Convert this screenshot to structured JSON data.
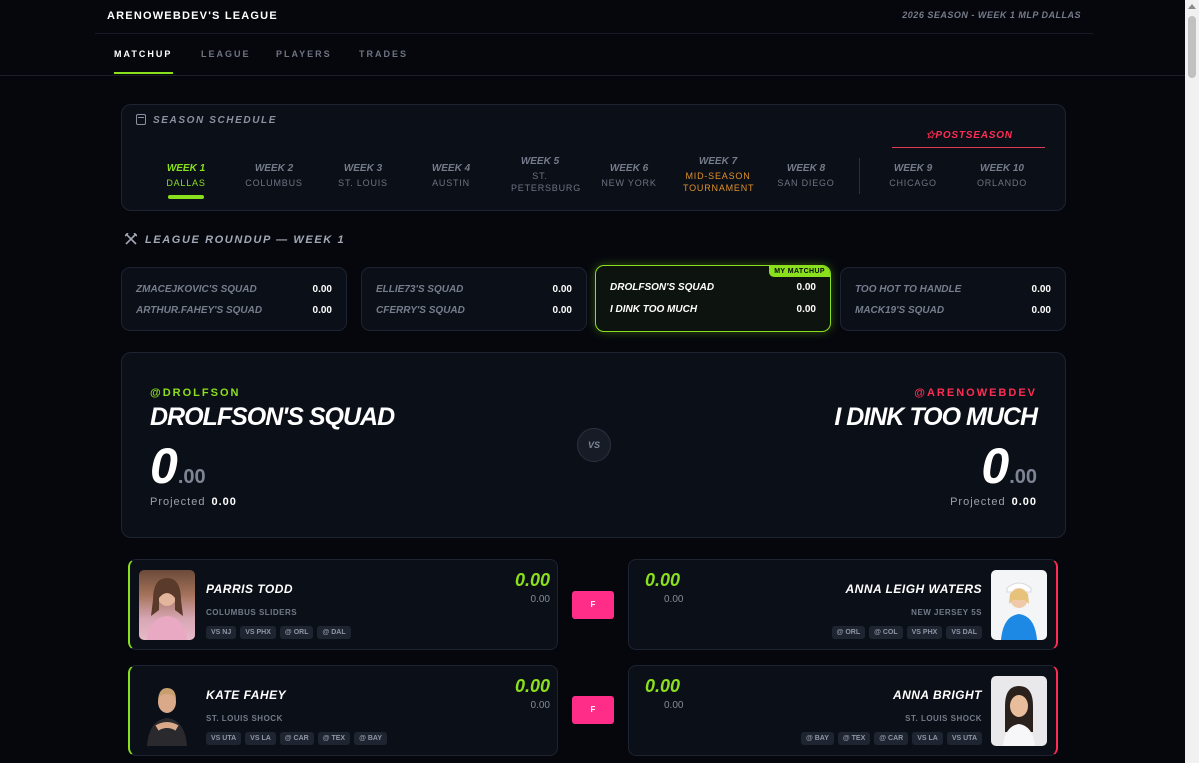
{
  "header": {
    "league_name": "ARENOWEBDEV'S LEAGUE",
    "season_info": "2026 SEASON - WEEK 1 MLP DALLAS"
  },
  "tabs": [
    {
      "label": "MATCHUP"
    },
    {
      "label": "LEAGUE"
    },
    {
      "label": "PLAYERS"
    },
    {
      "label": "TRADES"
    }
  ],
  "schedule": {
    "title": "SEASON SCHEDULE",
    "postseason_label": "✩POSTSEASON",
    "weeks": [
      {
        "week": "WEEK 1",
        "city": "DALLAS"
      },
      {
        "week": "WEEK 2",
        "city": "COLUMBUS"
      },
      {
        "week": "WEEK 3",
        "city": "ST. LOUIS"
      },
      {
        "week": "WEEK 4",
        "city": "AUSTIN"
      },
      {
        "week": "WEEK 5",
        "city": "ST. PETERSBURG"
      },
      {
        "week": "WEEK 6",
        "city": "NEW YORK"
      },
      {
        "week": "WEEK 7",
        "city": "MID-SEASON TOURNAMENT"
      },
      {
        "week": "WEEK 8",
        "city": "SAN DIEGO"
      },
      {
        "week": "WEEK 9",
        "city": "CHICAGO"
      },
      {
        "week": "WEEK 10",
        "city": "ORLANDO"
      }
    ]
  },
  "roundup": {
    "title": "LEAGUE ROUNDUP — WEEK 1",
    "my_matchup_badge": "MY MATCHUP",
    "matchups": [
      {
        "team1": "ZMACEJKOVIC'S SQUAD",
        "score1": "0.00",
        "team2": "ARTHUR.FAHEY'S SQUAD",
        "score2": "0.00"
      },
      {
        "team1": "ELLIE73'S SQUAD",
        "score1": "0.00",
        "team2": "CFERRY'S SQUAD",
        "score2": "0.00"
      },
      {
        "team1": "DROLFSON'S SQUAD",
        "score1": "0.00",
        "team2": "I DINK TOO MUCH",
        "score2": "0.00"
      },
      {
        "team1": "TOO HOT TO HANDLE",
        "score1": "0.00",
        "team2": "MACK19'S SQUAD",
        "score2": "0.00"
      }
    ]
  },
  "matchup": {
    "vs_label": "VS",
    "projected_label": "Projected",
    "home": {
      "handle": "@DROLFSON",
      "team": "DROLFSON'S SQUAD",
      "score_int": "0",
      "score_dec": ".00",
      "projected": "0.00"
    },
    "away": {
      "handle": "@ARENOWEBDEV",
      "team": "I DINK TOO MUCH",
      "score_int": "0",
      "score_dec": ".00",
      "projected": "0.00"
    }
  },
  "lineup": [
    {
      "slot": "F",
      "home": {
        "name": "PARRIS TODD",
        "team": "COLUMBUS SLIDERS",
        "score": "0.00",
        "projected": "0.00",
        "games": [
          "VS NJ",
          "VS PHX",
          "@ ORL",
          "@ DAL"
        ]
      },
      "away": {
        "name": "ANNA LEIGH WATERS",
        "team": "NEW JERSEY 5S",
        "score": "0.00",
        "projected": "0.00",
        "games": [
          "@ ORL",
          "@ COL",
          "VS PHX",
          "VS DAL"
        ]
      }
    },
    {
      "slot": "F",
      "home": {
        "name": "KATE FAHEY",
        "team": "ST. LOUIS SHOCK",
        "score": "0.00",
        "projected": "0.00",
        "games": [
          "VS UTA",
          "VS LA",
          "@ CAR",
          "@ TEX",
          "@ BAY"
        ]
      },
      "away": {
        "name": "ANNA BRIGHT",
        "team": "ST. LOUIS SHOCK",
        "score": "0.00",
        "projected": "0.00",
        "games": [
          "@ BAY",
          "@ TEX",
          "@ CAR",
          "VS LA",
          "VS UTA"
        ]
      }
    }
  ],
  "colors": {
    "accent_green": "#8ae01c",
    "accent_red": "#ff2d55",
    "flex_pink": "#ff2d87",
    "background": "#05070d"
  }
}
